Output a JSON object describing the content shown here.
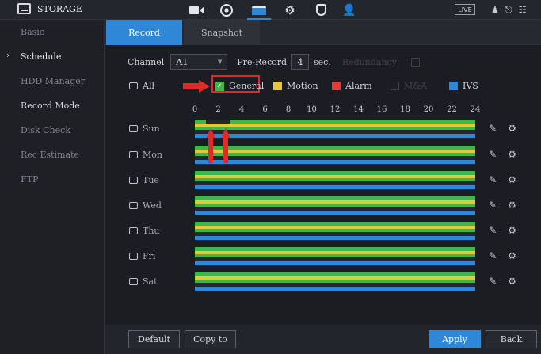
{
  "app": {
    "title": "STORAGE",
    "live_label": "LIVE"
  },
  "top_icons": [
    "camera-icon",
    "network-icon",
    "storage-icon",
    "system-gear-icon",
    "security-shield-icon",
    "account-icon"
  ],
  "sidebar": {
    "items": [
      {
        "label": "Basic"
      },
      {
        "label": "Schedule"
      },
      {
        "label": "HDD Manager"
      },
      {
        "label": "Record Mode"
      },
      {
        "label": "Disk Check"
      },
      {
        "label": "Rec Estimate"
      },
      {
        "label": "FTP"
      }
    ],
    "current": "Schedule"
  },
  "tabs": [
    {
      "label": "Record"
    },
    {
      "label": "Snapshot"
    }
  ],
  "form": {
    "channel_label": "Channel",
    "channel_value": "A1",
    "prerecord_label": "Pre-Record",
    "prerecord_value": "4",
    "prerecord_unit": "sec.",
    "redundancy_label": "Redundancy"
  },
  "legend": {
    "all_label": "All",
    "items": [
      {
        "label": "General",
        "color": "#3fb64a",
        "checked": true
      },
      {
        "label": "Motion",
        "color": "#e3c93a",
        "checked": false
      },
      {
        "label": "Alarm",
        "color": "#e23b3b",
        "checked": false
      },
      {
        "label": "M&A",
        "color": "#1b1d23",
        "checked": false
      },
      {
        "label": "IVS",
        "color": "#2f87d8",
        "checked": false
      }
    ]
  },
  "hours": [
    "0",
    "2",
    "4",
    "6",
    "8",
    "10",
    "12",
    "14",
    "16",
    "18",
    "20",
    "22",
    "24"
  ],
  "days": [
    {
      "label": "Sun"
    },
    {
      "label": "Mon"
    },
    {
      "label": "Tue"
    },
    {
      "label": "Wed"
    },
    {
      "label": "Thu"
    },
    {
      "label": "Fri"
    },
    {
      "label": "Sat"
    }
  ],
  "buttons": {
    "default": "Default",
    "copy": "Copy to",
    "apply": "Apply",
    "back": "Back"
  }
}
